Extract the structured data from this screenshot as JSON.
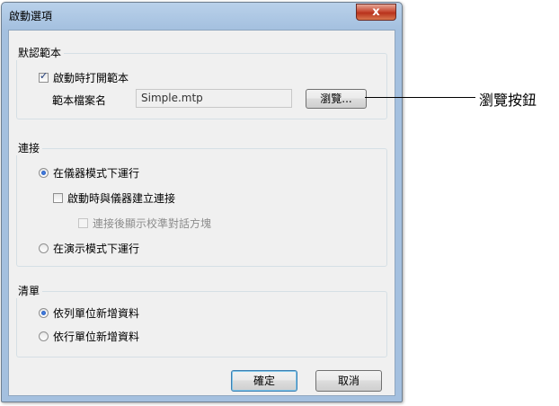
{
  "window": {
    "title": "啟動選項",
    "close_label": "x"
  },
  "template_group": {
    "legend": "默認範本",
    "open_on_start_label": "啟動時打開範本",
    "open_on_start_checked": true,
    "file_label": "範本檔案名",
    "file_value": "Simple.mtp",
    "browse_label": "瀏覽..."
  },
  "connect_group": {
    "legend": "連接",
    "instrument_mode_label": "在儀器模式下運行",
    "instrument_mode_selected": true,
    "connect_on_start_label": "啟動時與儀器建立連接",
    "connect_on_start_checked": false,
    "show_cal_dialog_label": "連接後顯示校準對話方塊",
    "show_cal_dialog_checked": false,
    "demo_mode_label": "在演示模式下運行",
    "demo_mode_selected": false
  },
  "list_group": {
    "legend": "清單",
    "add_by_column_label": "依列單位新增資料",
    "add_by_column_selected": true,
    "add_by_row_label": "依行單位新增資料",
    "add_by_row_selected": false
  },
  "buttons": {
    "ok_label": "確定",
    "cancel_label": "取消"
  },
  "annotation": {
    "text": "瀏覽按鈕"
  }
}
